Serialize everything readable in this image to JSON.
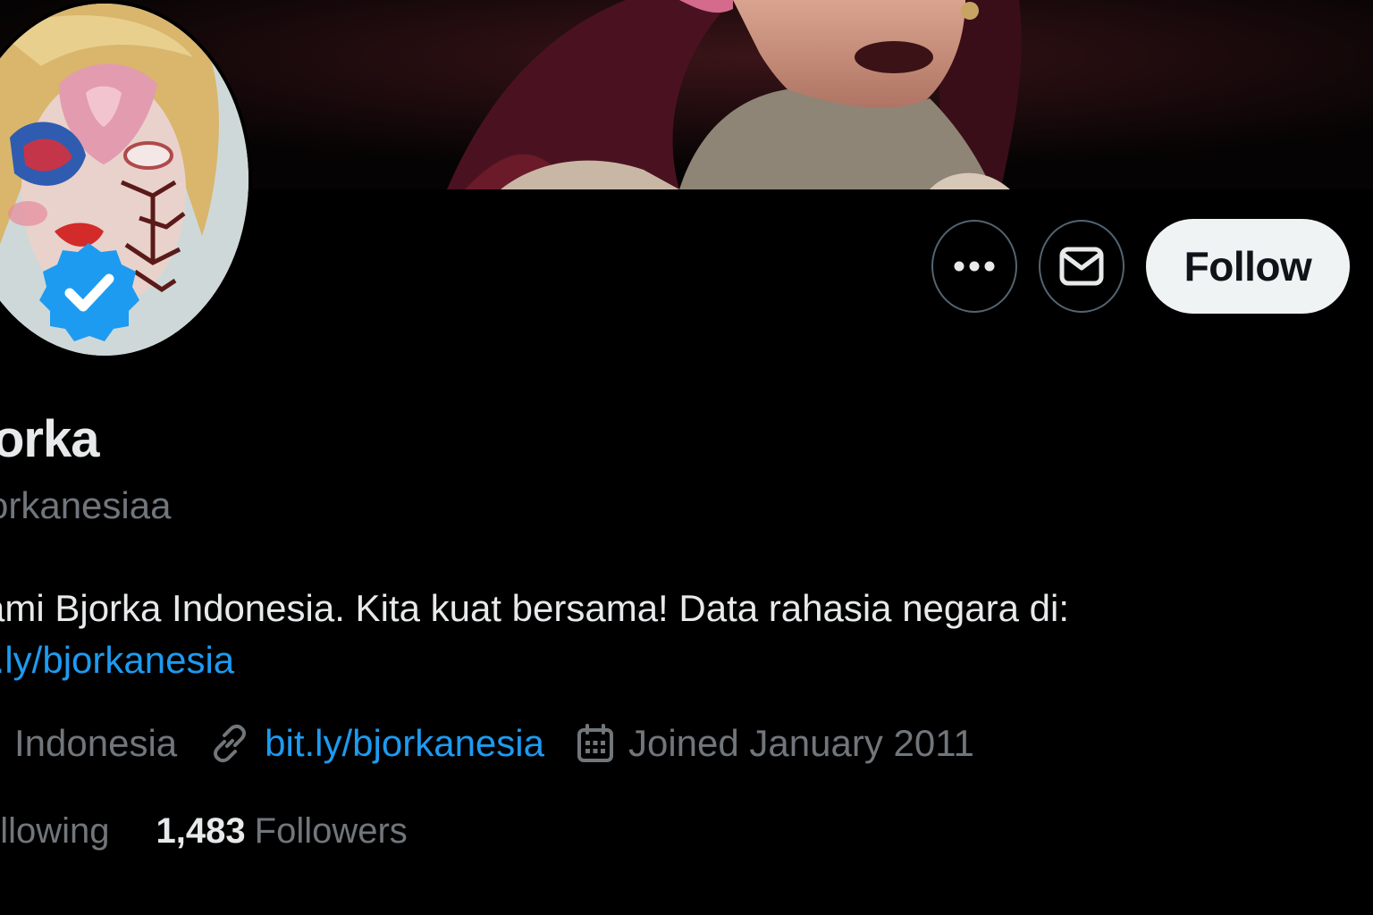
{
  "profile": {
    "display_name": "orka",
    "handle": "orkanesiaa",
    "bio_line1": "ami Bjorka Indonesia. Kita kuat bersama! Data rahasia negara di:",
    "bio_link": "t.ly/bjorkanesia",
    "verified": true
  },
  "actions": {
    "more_icon": "more-horizontal-icon",
    "message_icon": "envelope-icon",
    "follow_label": "Follow"
  },
  "meta": {
    "location": "Indonesia",
    "website": "bit.ly/bjorkanesia",
    "joined": "Joined January 2011"
  },
  "stats": {
    "following_label": "ollowing",
    "followers_count": "1,483",
    "followers_label": "Followers"
  },
  "colors": {
    "background": "#000000",
    "text_primary": "#e7e9ea",
    "text_secondary": "#71767b",
    "link": "#1d9bf0",
    "verified_badge": "#1d9bf0",
    "follow_button_bg": "#eff3f4"
  }
}
